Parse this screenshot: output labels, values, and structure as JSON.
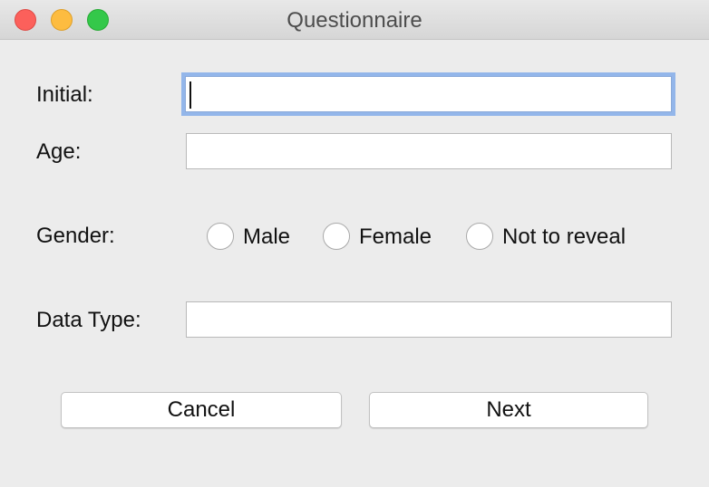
{
  "window": {
    "title": "Questionnaire"
  },
  "form": {
    "initial_label": "Initial:",
    "initial_value": "",
    "age_label": "Age:",
    "age_value": "",
    "gender_label": "Gender:",
    "gender_options": [
      "Male",
      "Female",
      "Not to reveal"
    ],
    "gender_selected": null,
    "data_type_label": "Data Type:",
    "data_type_value": ""
  },
  "buttons": {
    "cancel_label": "Cancel",
    "next_label": "Next"
  },
  "colors": {
    "close": "#fc605b",
    "minimize": "#fdbc40",
    "maximize": "#34c84a",
    "focus_ring": "#93b6ea"
  }
}
